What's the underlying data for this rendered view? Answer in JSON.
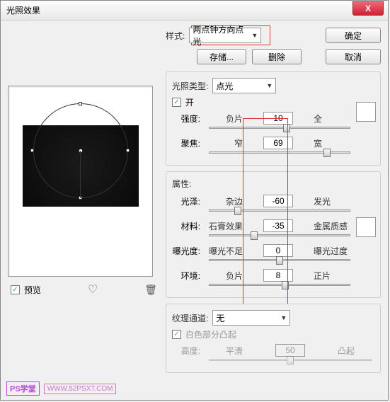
{
  "window": {
    "title": "光照效果"
  },
  "buttons": {
    "ok": "确定",
    "cancel": "取消",
    "save": "存储...",
    "delete": "删除",
    "close": "X"
  },
  "style": {
    "label": "样式:",
    "value": "两点钟方向点光"
  },
  "preview": {
    "checkbox_label": "预览"
  },
  "light_type": {
    "label": "光照类型:",
    "value": "点光",
    "on_label": "开"
  },
  "sliders": {
    "intensity": {
      "main": "强度:",
      "left": "负片",
      "value": "10",
      "right": "全"
    },
    "focus": {
      "main": "聚焦:",
      "left": "窄",
      "value": "69",
      "right": "宽"
    }
  },
  "props": {
    "header": "属性:",
    "gloss": {
      "main": "光泽:",
      "left": "杂边",
      "value": "-60",
      "right": "发光"
    },
    "material": {
      "main": "材料:",
      "left": "石膏效果",
      "value": "-35",
      "right": "金属质感"
    },
    "exposure": {
      "main": "曝光度:",
      "left": "曝光不足",
      "value": "0",
      "right": "曝光过度"
    },
    "ambience": {
      "main": "环境:",
      "left": "负片",
      "value": "8",
      "right": "正片"
    }
  },
  "texture": {
    "label": "纹理通道:",
    "value": "无",
    "white_high": "白色部分凸起",
    "height": {
      "main": "高度:",
      "left": "平滑",
      "value": "50",
      "right": "凸起"
    }
  },
  "watermark": {
    "a": "PS学堂",
    "b": "WWW.52PSXT.COM"
  }
}
